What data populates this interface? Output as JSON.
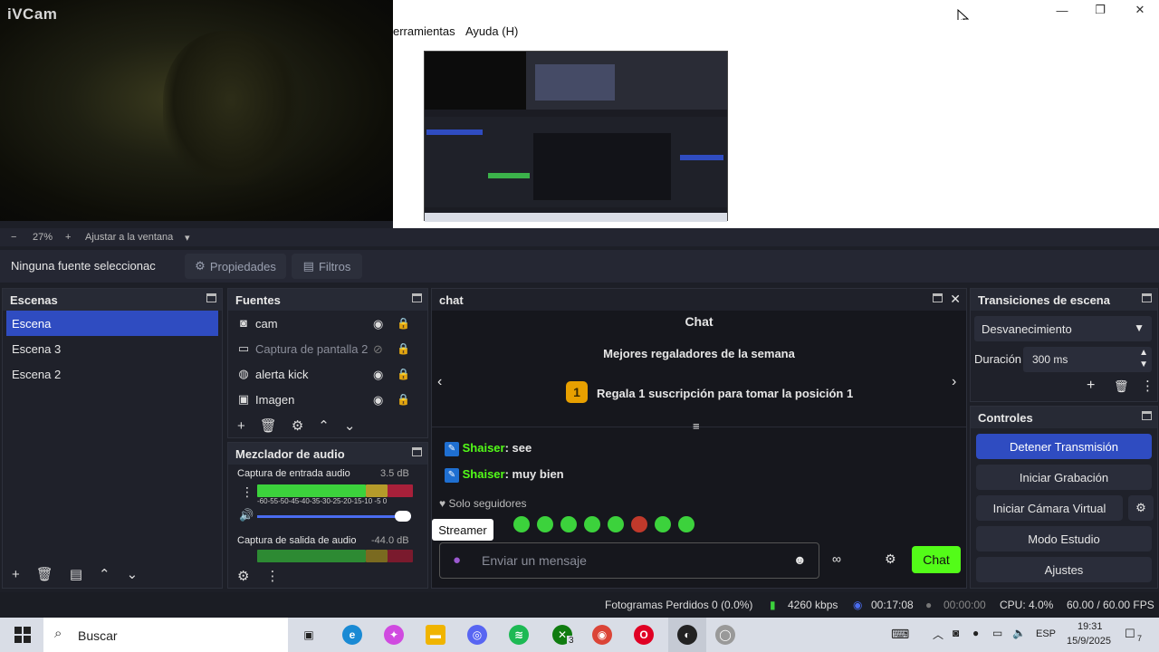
{
  "cam_overlay": {
    "title": "iVCam"
  },
  "window": {
    "minimize": "—",
    "maximize": "❐",
    "close": "✕"
  },
  "menu": {
    "tools": "erramientas",
    "help": "Ayuda (H)"
  },
  "zoom": {
    "minus": "−",
    "value": "27%",
    "plus": "+",
    "fit": "Ajustar a la ventana",
    "dropdown": "▾"
  },
  "source_bar": {
    "none_selected": "Ninguna fuente seleccionac",
    "properties": "Propiedades",
    "filters": "Filtros"
  },
  "scenes": {
    "title": "Escenas",
    "items": [
      {
        "label": "Escena",
        "selected": true
      },
      {
        "label": "Escena 3",
        "selected": false
      },
      {
        "label": "Escena 2",
        "selected": false
      }
    ]
  },
  "sources": {
    "title": "Fuentes",
    "items": [
      {
        "label": "cam",
        "icon": "camera-icon",
        "visible": true
      },
      {
        "label": "Captura de pantalla 2",
        "icon": "monitor-icon",
        "visible": false
      },
      {
        "label": "alerta kick",
        "icon": "globe-icon",
        "visible": true
      },
      {
        "label": "Imagen",
        "icon": "image-icon",
        "visible": true
      }
    ]
  },
  "audio_mixer": {
    "title": "Mezclador de audio",
    "channels": [
      {
        "name": "Captura de entrada audio",
        "level": "3.5 dB",
        "scale": "-60-55-50-45-40-35-30-25-20-15-10 -5  0",
        "volume": 1.0
      },
      {
        "name": "Captura de salida de audio",
        "level": "-44.0 dB"
      }
    ]
  },
  "chat": {
    "dock_title": "chat",
    "header": "Chat",
    "top_gifters": "Mejores regaladores de la semana",
    "rank": "1",
    "gift_prompt": "Regala 1 suscripción para tomar la posición 1",
    "messages": [
      {
        "user": "Shaiser",
        "text": ": see"
      },
      {
        "user": "Shaiser",
        "text": ": muy bien"
      }
    ],
    "followers_only": "Solo seguidores",
    "tooltip": "Streamer",
    "placeholder": "Enviar un mensaje",
    "send": "Chat"
  },
  "transitions": {
    "title": "Transiciones de escena",
    "selected": "Desvanecimiento",
    "duration_label": "Duración",
    "duration": "300 ms"
  },
  "controls": {
    "title": "Controles",
    "stop_stream": "Detener Transmisión",
    "start_record": "Iniciar Grabación",
    "virtual_cam": "Iniciar Cámara Virtual",
    "studio_mode": "Modo Estudio",
    "settings": "Ajustes"
  },
  "status": {
    "dropped": "Fotogramas Perdidos 0 (0.0%)",
    "bitrate": "4260 kbps",
    "stream_time": "00:17:08",
    "record_time": "00:00:00",
    "cpu": "CPU: 4.0%",
    "fps": "60.00 / 60.00 FPS"
  },
  "taskbar": {
    "search": "Buscar",
    "xbox_badge": "3",
    "lang": "ESP",
    "time": "19:31",
    "date": "15/9/2025",
    "notif": "7"
  },
  "colors": {
    "accent": "#2f4cc1",
    "chat_send": "#53fc18",
    "kick_user": "#53fc18"
  }
}
